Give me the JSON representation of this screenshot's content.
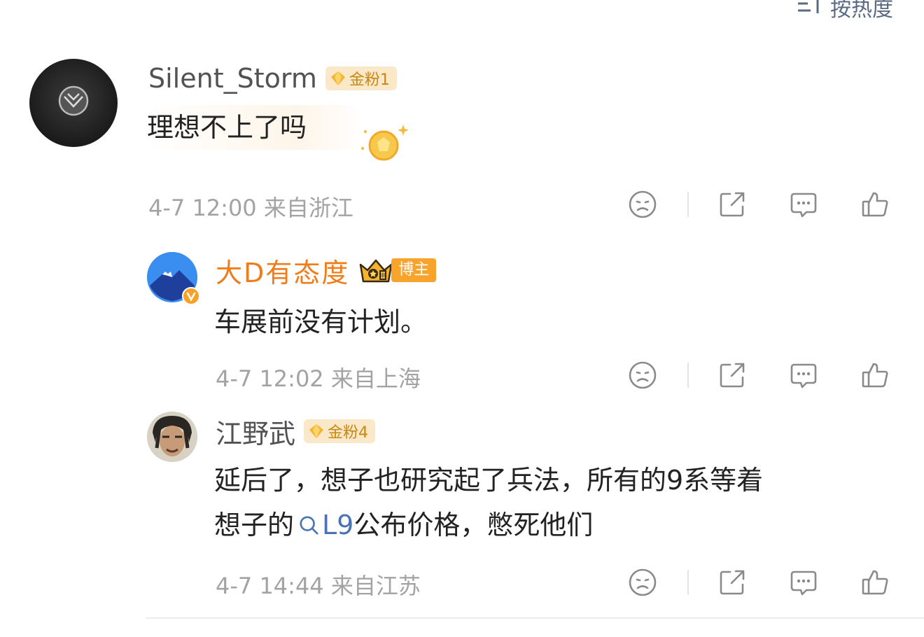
{
  "header": {
    "sort_label": "按热度",
    "sort_icon": "sort-icon"
  },
  "comments": [
    {
      "username": "Silent_Storm",
      "badge": "金粉1",
      "text": "理想不上了吗",
      "time": "4-7 12:00",
      "location": "来自浙江"
    },
    {
      "username": "大D有态度",
      "badge": "博主",
      "text": "车展前没有计划。",
      "time": "4-7 12:02",
      "location": "来自上海"
    },
    {
      "username": "江野武",
      "badge": "金粉4",
      "text_line1": "延后了，想子也研究起了兵法，所有的9系等着",
      "text_line2_pre": "想子的",
      "topic": "L9",
      "text_line2_post": "公布价格，憋死他们",
      "time": "4-7 14:44",
      "location": "来自江苏"
    }
  ],
  "colors": {
    "accent_orange": "#f07d1a",
    "link_blue": "#4a73b5",
    "gold_badge": "#fbe8c8",
    "meta_gray": "#a3a3a3"
  },
  "icons": [
    "dislike-icon",
    "share-icon",
    "comment-icon",
    "like-icon"
  ]
}
